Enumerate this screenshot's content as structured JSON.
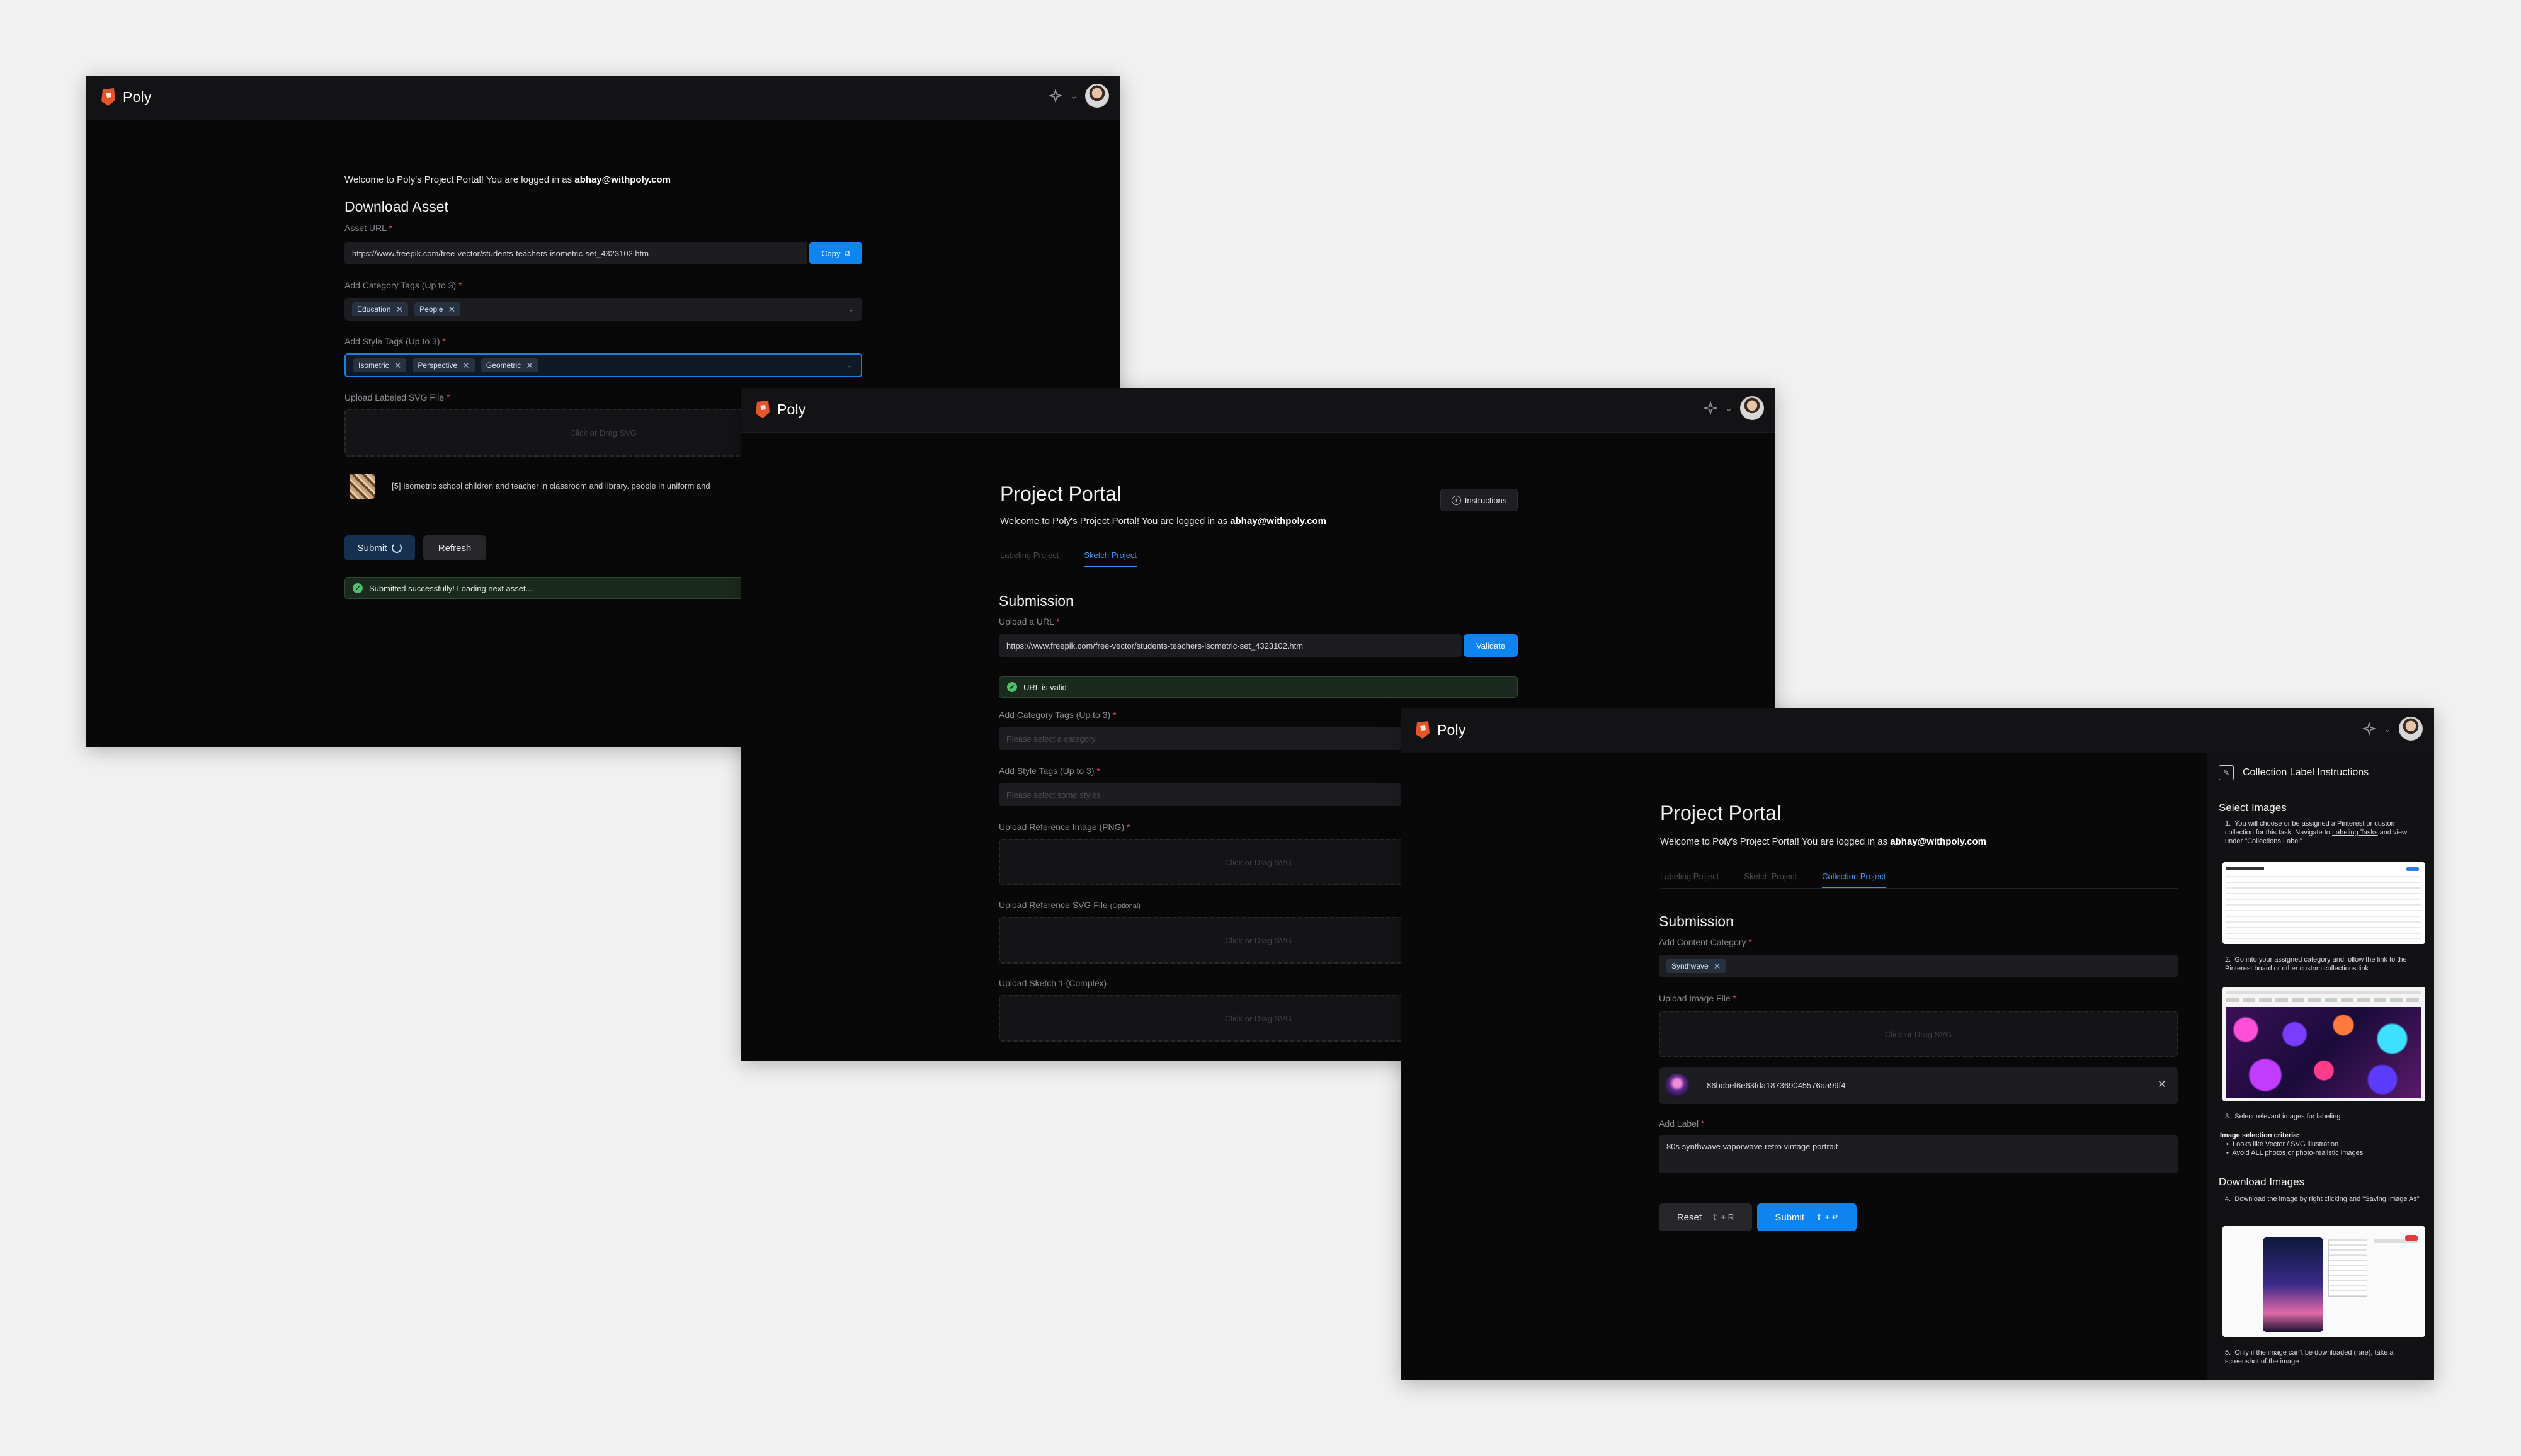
{
  "app": {
    "name": "Poly"
  },
  "welcome": {
    "prefix": "Welcome to Poly's Project Portal! You are logged in as ",
    "email": "abhay@withpoly.com"
  },
  "win1": {
    "title": "Download Asset",
    "asset_url_label": "Asset URL",
    "asset_url_value": "https://www.freepik.com/free-vector/students-teachers-isometric-set_4323102.htm",
    "copy_label": "Copy",
    "category_label": "Add Category Tags (Up to 3)",
    "category_tags": [
      "Education",
      "People"
    ],
    "style_label": "Add Style Tags (Up to 3)",
    "style_tags": [
      "Isometric",
      "Perspective",
      "Geometric"
    ],
    "upload_label": "Upload Labeled SVG File",
    "drop_text": "Click or Drag SVG",
    "asset_description": "[5] Isometric school children and teacher in classroom and library. people in uniform and",
    "submit_label": "Submit",
    "refresh_label": "Refresh",
    "success_text": "Submitted successfully! Loading next asset..."
  },
  "win2": {
    "title": "Project Portal",
    "instructions_label": "Instructions",
    "tabs": [
      "Labeling Project",
      "Sketch Project"
    ],
    "section": "Submission",
    "url_label": "Upload a URL",
    "url_value": "https://www.freepik.com/free-vector/students-teachers-isometric-set_4323102.htm",
    "validate_label": "Validate",
    "valid_text": "URL is valid",
    "category_label": "Add Category Tags (Up to 3)",
    "category_placeholder": "Please select a category",
    "style_label": "Add Style Tags (Up to 3)",
    "style_placeholder": "Please select some styles",
    "ref_image_label": "Upload Reference Image (PNG)",
    "ref_svg_label": "Upload Reference SVG File",
    "ref_svg_optional": "(Optional)",
    "sketch_label": "Upload Sketch 1 (Complex)",
    "drop_text": "Click or Drag SVG"
  },
  "win3": {
    "title": "Project Portal",
    "tabs": [
      "Labeling Project",
      "Sketch Project",
      "Collection Project"
    ],
    "section": "Submission",
    "content_category_label": "Add Content Category",
    "content_tag": "Synthwave",
    "upload_label": "Upload Image File",
    "drop_text": "Click or Drag SVG",
    "file_name": "86bdbef6e63fda187369045576aa99f4",
    "add_label_label": "Add Label",
    "label_value": "80s synthwave vaporwave retro vintage portrait",
    "reset_label": "Reset",
    "reset_shortcut": "⇧ + R",
    "submit_label": "Submit",
    "submit_shortcut": "⇧ + ↵",
    "sidebar": {
      "title": "Collection Label Instructions",
      "select_heading": "Select Images",
      "step1_a": "You will choose or be assigned a Pinterest or custom collection for this task. Navigate to ",
      "step1_link": "Labeling Tasks",
      "step1_b": " and view under \"Collections Label\"",
      "step2": "Go into your assigned category and follow the link to the Pinterest board or other custom collections link",
      "step3": "Select relevant images for labeling",
      "criteria_heading": "Image selection criteria:",
      "criteria": [
        "Looks like Vector / SVG illustration",
        "Avoid ALL photos or photo-realistic images"
      ],
      "download_heading": "Download Images",
      "step4": "Download the image by right clicking and \"Saving Image As\"",
      "step5": "Only if the image can't be downloaded (rare), take a screenshot of the image"
    }
  }
}
